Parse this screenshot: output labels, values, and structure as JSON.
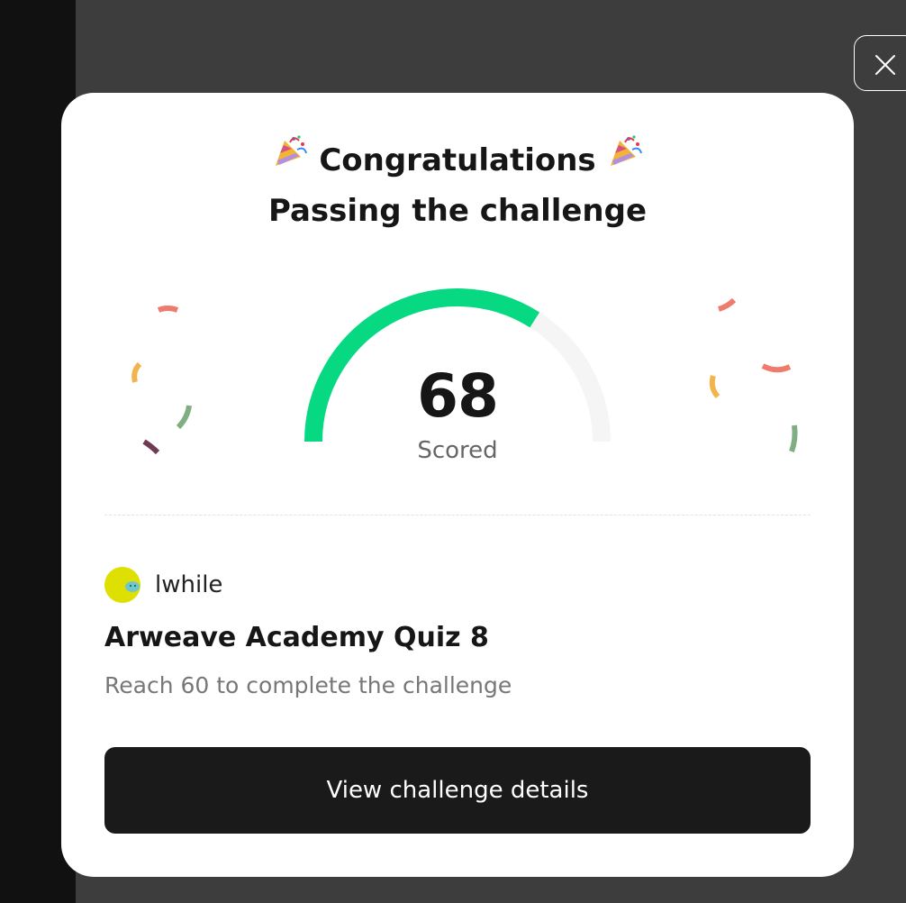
{
  "modal": {
    "title": "Congratulations",
    "subtitle": "Passing the challenge",
    "score": {
      "value": "68",
      "label": "Scored",
      "fraction": 0.68
    },
    "user": {
      "name": "lwhile"
    },
    "challenge": {
      "title": "Arweave Academy Quiz 8",
      "description": "Reach 60 to complete the challenge"
    },
    "cta_label": "View challenge details"
  },
  "icons": {
    "title_left": "party-popper-icon",
    "title_right": "party-popper-icon",
    "close": "close-icon"
  },
  "colors": {
    "gauge_fill": "#06d982",
    "gauge_track": "#f5f5f5",
    "cta_background": "#1a1a1a",
    "backdrop": "#3d3d3d",
    "avatar": "#dde000"
  }
}
